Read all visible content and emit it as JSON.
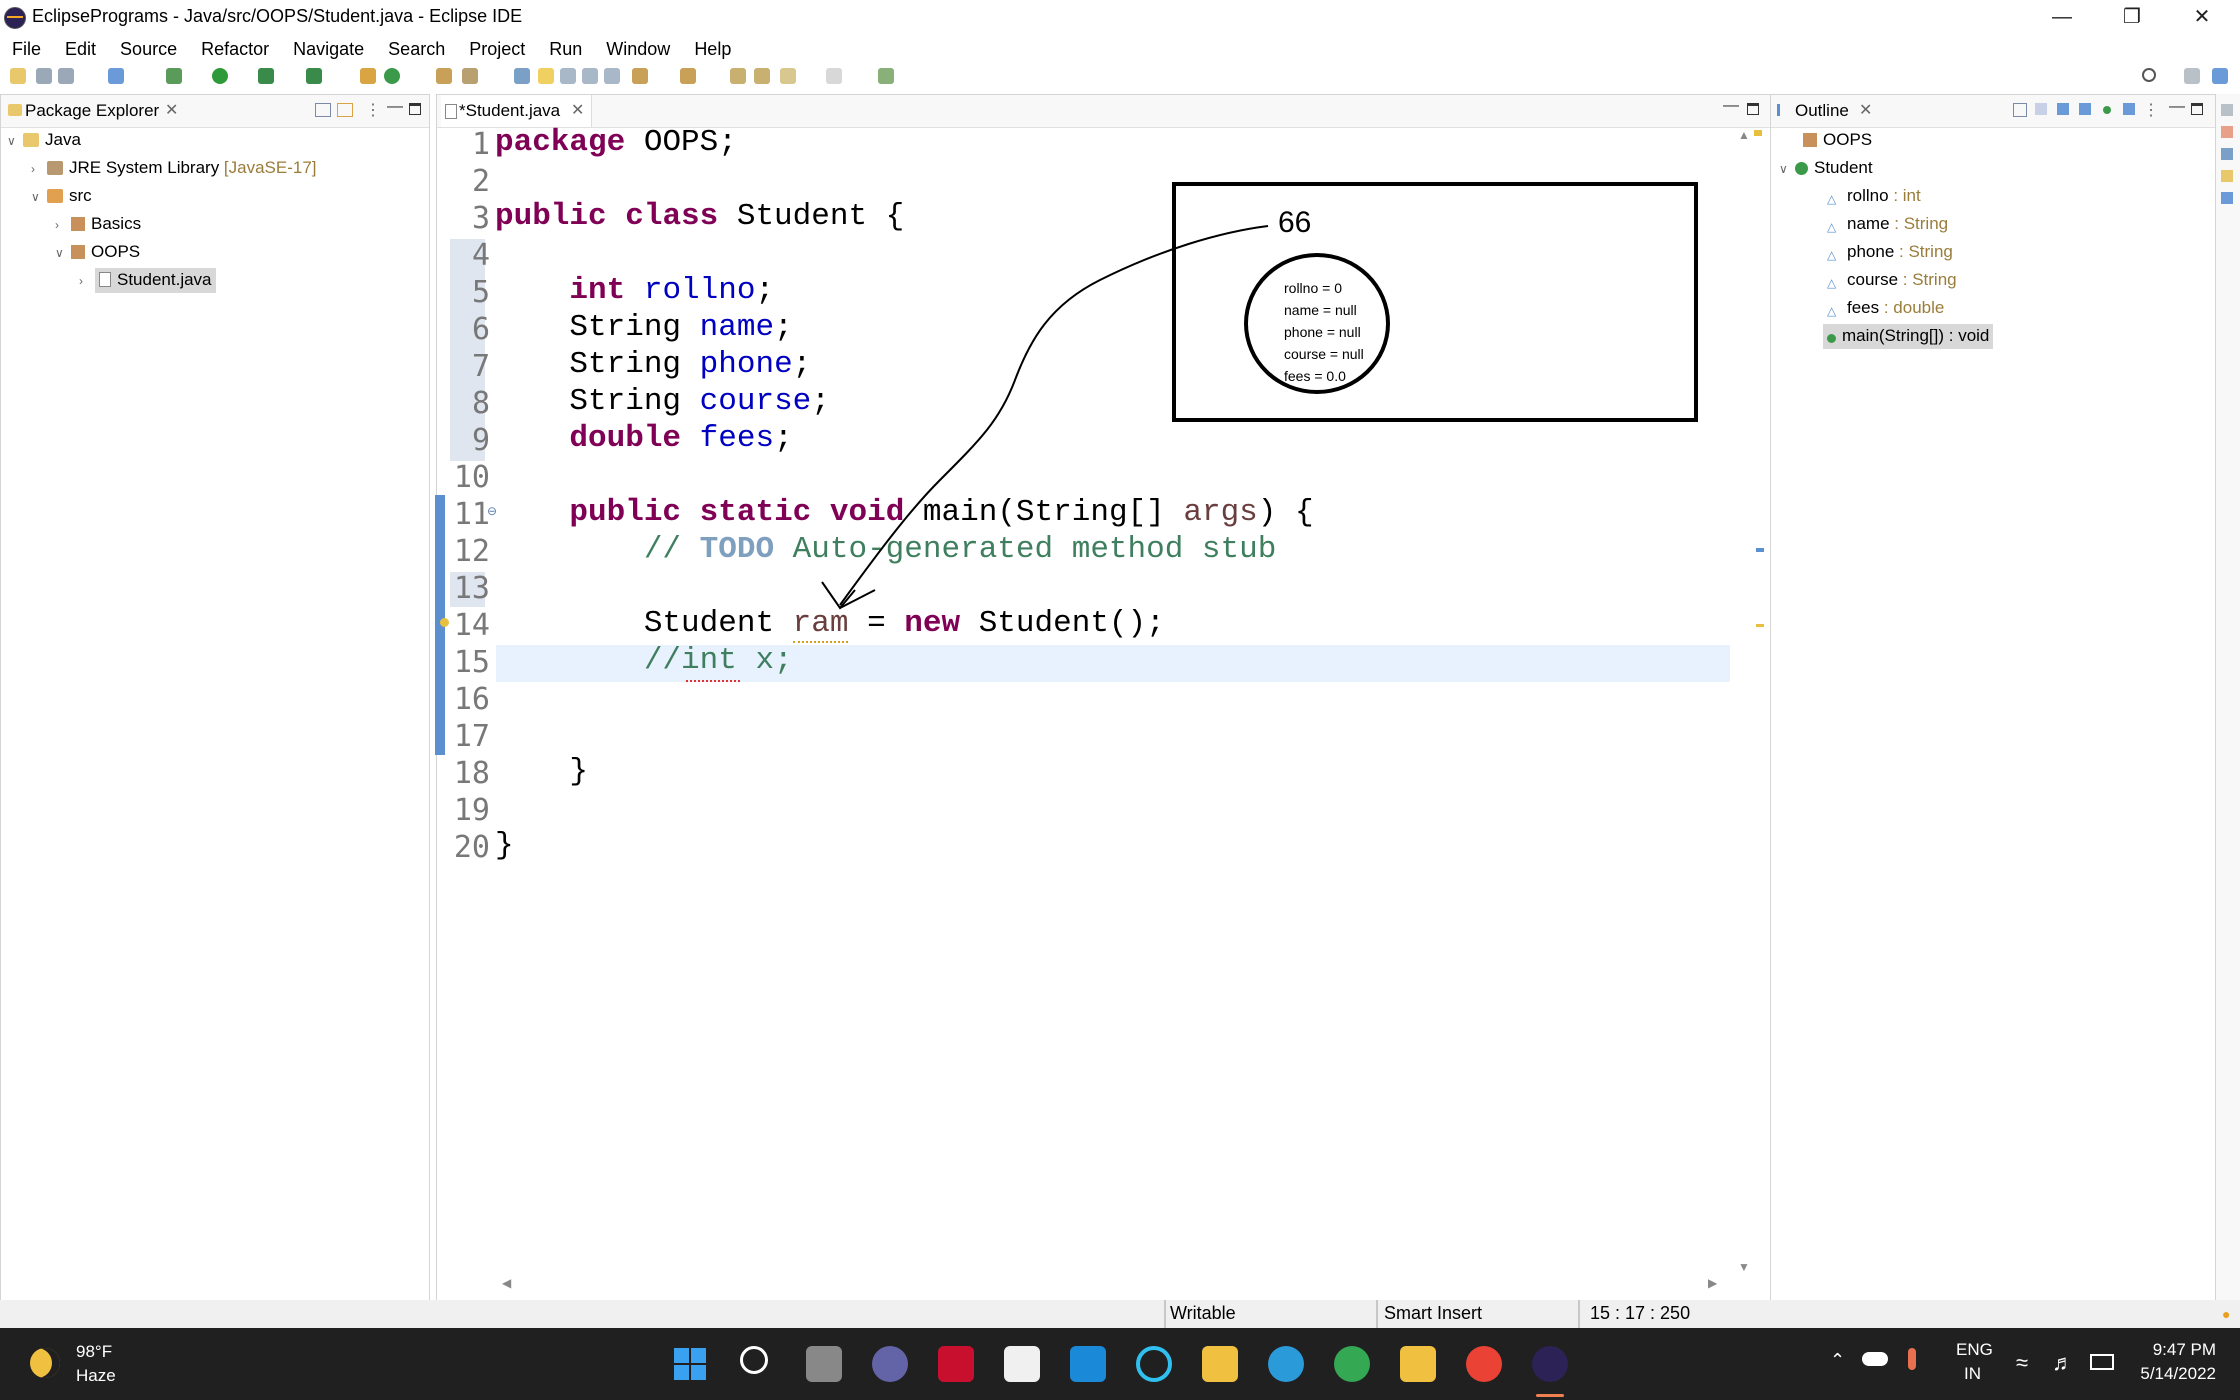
{
  "window": {
    "title": "EclipsePrograms - Java/src/OOPS/Student.java - Eclipse IDE"
  },
  "menu": [
    "File",
    "Edit",
    "Source",
    "Refactor",
    "Navigate",
    "Search",
    "Project",
    "Run",
    "Window",
    "Help"
  ],
  "package_explorer": {
    "title": "Package Explorer",
    "items": [
      {
        "label": "Java",
        "decoration": ""
      },
      {
        "label": "JRE System Library",
        "decoration": " [JavaSE-17]"
      },
      {
        "label": "src",
        "decoration": ""
      },
      {
        "label": "Basics",
        "decoration": ""
      },
      {
        "label": "OOPS",
        "decoration": ""
      },
      {
        "label": "Student.java",
        "decoration": ""
      }
    ]
  },
  "editor": {
    "tab": "*Student.java",
    "line_numbers": [
      "1",
      "2",
      "3",
      "4",
      "5",
      "6",
      "7",
      "8",
      "9",
      "10",
      "11",
      "12",
      "13",
      "14",
      "15",
      "16",
      "17",
      "18",
      "19",
      "20"
    ],
    "tokens": {
      "package": "package",
      "pkgname": " OOPS;",
      "public": "public",
      "class": "class",
      "classname": " Student {",
      "int": "int",
      "rollno": "rollno",
      "String": "String",
      "name": "name",
      "phone": "phone",
      "course": "course",
      "double": "double",
      "fees": "fees",
      "semi": ";",
      "static": "static",
      "void": "void",
      "main": " main(String[] ",
      "args": "args",
      "mainend": ") {",
      "comment": "// ",
      "todo": "TODO",
      "comment_rest": " Auto-generated method stub",
      "student": "Student ",
      "ram": "ram",
      "eq": " = ",
      "new": "new",
      "ctor": " Student();",
      "intx": "//int x;",
      "closebrace": "}"
    }
  },
  "annotation": {
    "address": "66",
    "fields": [
      "rollno = 0",
      "name = null",
      "phone = null",
      "course = null",
      "fees = 0.0"
    ]
  },
  "outline": {
    "title": "Outline",
    "items": [
      {
        "name": "OOPS",
        "type": ""
      },
      {
        "name": "Student",
        "type": ""
      },
      {
        "name": "rollno",
        "type": " : int"
      },
      {
        "name": "name",
        "type": " : String"
      },
      {
        "name": "phone",
        "type": " : String"
      },
      {
        "name": "course",
        "type": " : String"
      },
      {
        "name": "fees",
        "type": " : double"
      },
      {
        "name": "main(String[]) : void",
        "type": ""
      }
    ]
  },
  "status": {
    "writable": "Writable",
    "insert_mode": "Smart Insert",
    "position": "15 : 17 : 250"
  },
  "taskbar": {
    "weather_temp": "98°F",
    "weather_desc": "Haze",
    "lang1": "ENG",
    "lang2": "IN",
    "time": "9:47 PM",
    "date": "5/14/2022"
  }
}
